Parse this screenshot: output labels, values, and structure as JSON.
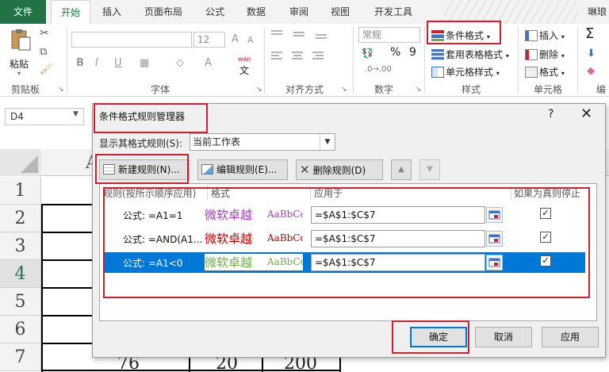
{
  "ribbon_tabs": [
    "文件",
    "开始",
    "插入",
    "页面布局",
    "公式",
    "数据",
    "审阅",
    "视图",
    "开发工具",
    "琳琅"
  ],
  "clipboard": {
    "paste_label": "粘贴",
    "group_label": "剪贴板"
  },
  "font": {
    "size_value": "12",
    "group_label": "字体",
    "bold": "B",
    "italic": "I",
    "underline": "U",
    "grow": "A",
    "shrink": "A",
    "color_a": "A",
    "wen": "wén",
    "wen_char": "文"
  },
  "alignment": {
    "group_label": "对齐方式"
  },
  "number": {
    "format_value": "常规",
    "percent": "%",
    "comma": "9",
    "group_label": "数字"
  },
  "styles": {
    "conditional_format": "条件格式",
    "table_format": "套用表格格式",
    "cell_styles": "单元格样式",
    "group_label": "样式"
  },
  "cells": {
    "insert": "插入",
    "delete": "删除",
    "format": "格式",
    "group_label": "单元格"
  },
  "editing": {
    "group_label": "编"
  },
  "name_box": "D4",
  "sheet": {
    "column_header": "A",
    "row_headers": [
      "1",
      "2",
      "3",
      "4",
      "5",
      "6",
      "7"
    ],
    "bottom_values": [
      "76",
      "20",
      "200"
    ]
  },
  "dialog": {
    "title": "条件格式规则管理器",
    "help": "?",
    "close": "✕",
    "show_rules_label": "显示其格式规则(S):",
    "show_rules_value": "当前工作表",
    "new_rule": "新建规则(N)...",
    "edit_rule": "编辑规则(E)...",
    "delete_rule": "删除规则(D)",
    "columns": {
      "rule": "规则(按所示顺序应用)",
      "format": "格式",
      "applies_to": "应用于",
      "stop_if_true": "如果为真则停止"
    },
    "rules": [
      {
        "name": "公式: =A1=1",
        "preview_cn": "微软卓越",
        "preview_en": "AaBbCc",
        "applies_to": "=$A$1:$C$7",
        "stop": "✓",
        "color": "#a23eb4",
        "selected": false
      },
      {
        "name": "公式: =AND(A1...",
        "preview_cn": "微软卓越",
        "preview_en": "AaBbCc",
        "applies_to": "=$A$1:$C$7",
        "stop": "✓",
        "color": "#c00000",
        "selected": false
      },
      {
        "name": "公式: =A1<0",
        "preview_cn": "微软卓越",
        "preview_en": "AaBbCc",
        "applies_to": "=$A$1:$C$7",
        "stop": "✓",
        "color": "#70ad47",
        "selected": true
      }
    ],
    "ok": "确定",
    "cancel": "取消",
    "apply": "应用"
  },
  "colors": {
    "excel_green": "#217346",
    "selection_blue": "#0078d7",
    "highlight_red": "#d01f2f"
  }
}
